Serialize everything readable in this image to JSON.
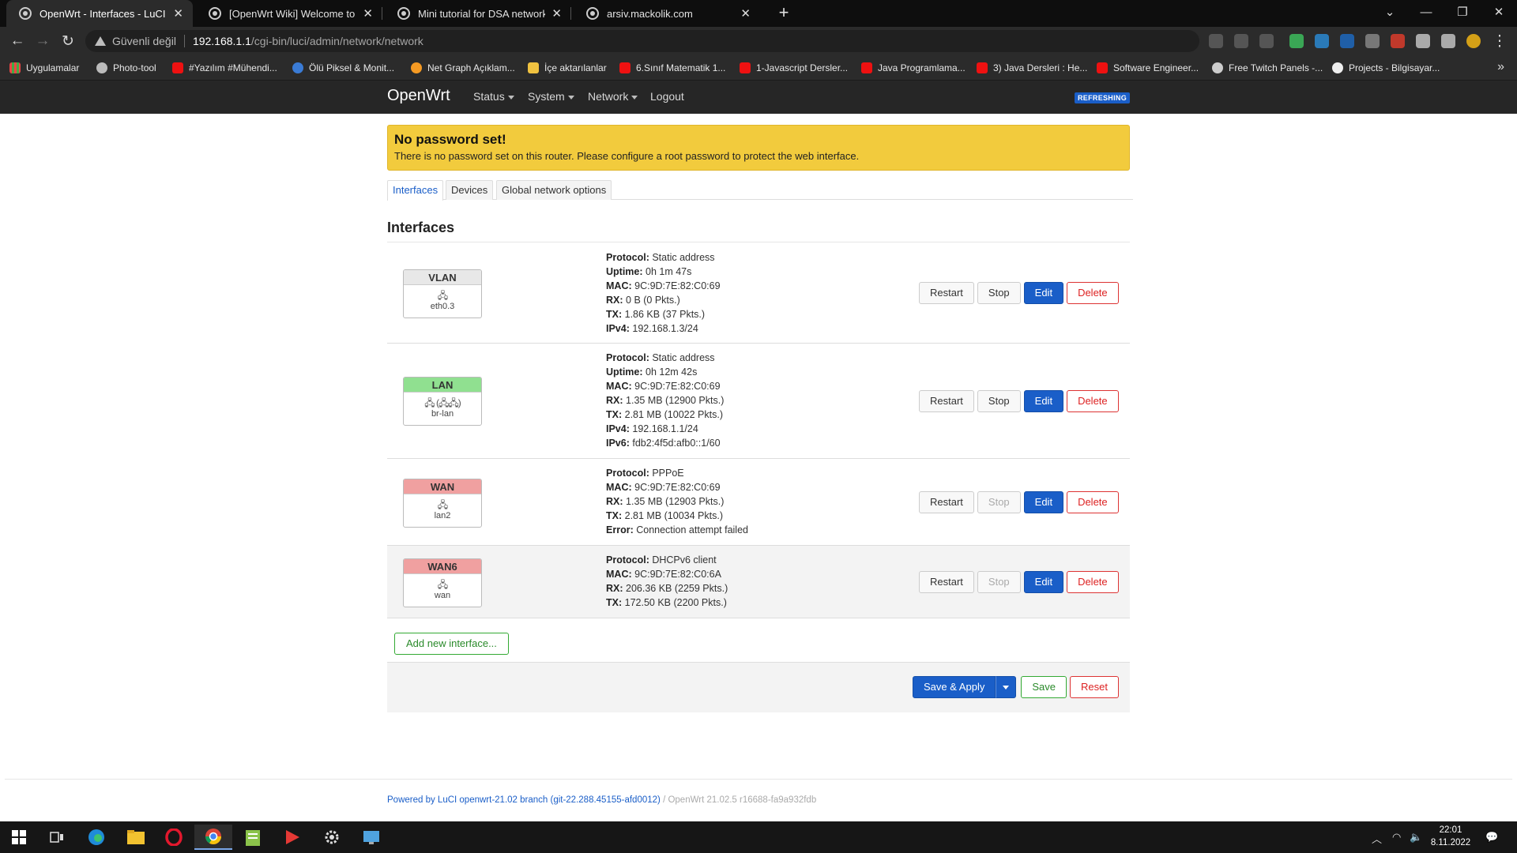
{
  "browser": {
    "tabs": [
      {
        "title": "OpenWrt - Interfaces - LuCI",
        "active": true
      },
      {
        "title": "[OpenWrt Wiki] Welcome to the",
        "active": false
      },
      {
        "title": "Mini tutorial for DSA network co",
        "active": false
      },
      {
        "title": "arsiv.mackolik.com",
        "active": false
      }
    ],
    "security_label": "Güvenli değil",
    "url_host": "192.168.1.1",
    "url_path": "/cgi-bin/luci/admin/network/network",
    "bookmarks": [
      {
        "label": "Uygulamalar",
        "icon": "apps-icon"
      },
      {
        "label": "Photo-tool",
        "icon": "globe-icon"
      },
      {
        "label": "#Yazılım #Mühendi...",
        "icon": "youtube-icon"
      },
      {
        "label": "Ölü Piksel & Monit...",
        "icon": "site-icon"
      },
      {
        "label": "Net Graph Açıklam...",
        "icon": "site-icon"
      },
      {
        "label": "İçe aktarılanlar",
        "icon": "folder-icon"
      },
      {
        "label": "6.Sınıf Matematik 1...",
        "icon": "youtube-icon"
      },
      {
        "label": "1-Javascript Dersler...",
        "icon": "youtube-icon"
      },
      {
        "label": "Java Programlama...",
        "icon": "youtube-icon"
      },
      {
        "label": "3) Java Dersleri : He...",
        "icon": "youtube-icon"
      },
      {
        "label": "Software Engineer...",
        "icon": "youtube-icon"
      },
      {
        "label": "Free Twitch Panels -...",
        "icon": "site-icon"
      },
      {
        "label": "Projects - Bilgisayar...",
        "icon": "github-icon"
      }
    ]
  },
  "header": {
    "brand": "OpenWrt",
    "menu": [
      "Status",
      "System",
      "Network",
      "Logout"
    ],
    "refreshing": "REFRESHING"
  },
  "alert": {
    "title": "No password set!",
    "message": "There is no password set on this router. Please configure a root password to protect the web interface."
  },
  "tabs": [
    "Interfaces",
    "Devices",
    "Global network options"
  ],
  "section_title": "Interfaces",
  "interfaces": [
    {
      "name": "VLAN",
      "color": "#e8e8e8",
      "device": "eth0.3",
      "icon": "🖧",
      "info": [
        {
          "k": "Protocol:",
          "v": "Static address"
        },
        {
          "k": "Uptime:",
          "v": "0h 1m 47s"
        },
        {
          "k": "MAC:",
          "v": "9C:9D:7E:82:C0:69"
        },
        {
          "k": "RX:",
          "v": "0 B (0 Pkts.)"
        },
        {
          "k": "TX:",
          "v": "1.86 KB (37 Pkts.)"
        },
        {
          "k": "IPv4:",
          "v": "192.168.1.3/24"
        }
      ],
      "stop_enabled": true
    },
    {
      "name": "LAN",
      "color": "#90e090",
      "device": "br-lan",
      "icon": "🖧 (🖧🖧)",
      "info": [
        {
          "k": "Protocol:",
          "v": "Static address"
        },
        {
          "k": "Uptime:",
          "v": "0h 12m 42s"
        },
        {
          "k": "MAC:",
          "v": "9C:9D:7E:82:C0:69"
        },
        {
          "k": "RX:",
          "v": "1.35 MB (12900 Pkts.)"
        },
        {
          "k": "TX:",
          "v": "2.81 MB (10022 Pkts.)"
        },
        {
          "k": "IPv4:",
          "v": "192.168.1.1/24"
        },
        {
          "k": "IPv6:",
          "v": "fdb2:4f5d:afb0::1/60"
        }
      ],
      "stop_enabled": true
    },
    {
      "name": "WAN",
      "color": "#f0a0a0",
      "device": "lan2",
      "icon": "🖧",
      "info": [
        {
          "k": "Protocol:",
          "v": "PPPoE"
        },
        {
          "k": "MAC:",
          "v": "9C:9D:7E:82:C0:69"
        },
        {
          "k": "RX:",
          "v": "1.35 MB (12903 Pkts.)"
        },
        {
          "k": "TX:",
          "v": "2.81 MB (10034 Pkts.)"
        },
        {
          "k": "Error:",
          "v": "Connection attempt failed"
        }
      ],
      "stop_enabled": false
    },
    {
      "name": "WAN6",
      "color": "#f0a0a0",
      "device": "wan",
      "icon": "🖧",
      "info": [
        {
          "k": "Protocol:",
          "v": "DHCPv6 client"
        },
        {
          "k": "MAC:",
          "v": "9C:9D:7E:82:C0:6A"
        },
        {
          "k": "RX:",
          "v": "206.36 KB (2259 Pkts.)"
        },
        {
          "k": "TX:",
          "v": "172.50 KB (2200 Pkts.)"
        }
      ],
      "stop_enabled": false
    }
  ],
  "row_buttons": {
    "restart": "Restart",
    "stop": "Stop",
    "edit": "Edit",
    "delete": "Delete"
  },
  "add_interface": "Add new interface...",
  "footer_buttons": {
    "save_apply": "Save & Apply",
    "save": "Save",
    "reset": "Reset"
  },
  "powered_by": "Powered by LuCI openwrt-21.02 branch (git-22.288.45155-afd0012)",
  "version": " / OpenWrt 21.02.5 r16688-fa9a932fdb",
  "clock": {
    "time": "22:01",
    "date": "8.11.2022"
  }
}
